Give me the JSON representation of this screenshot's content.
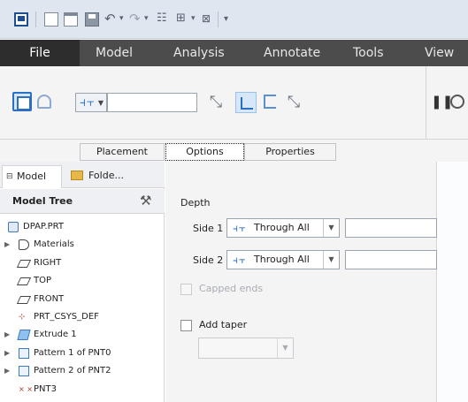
{
  "window": {
    "quick_access_chevron": "▾",
    "close_glyph": "⊠"
  },
  "menu": {
    "tabs": [
      "File",
      "Model",
      "Analysis",
      "Annotate",
      "Tools",
      "View"
    ]
  },
  "ribbon": {
    "depth_value": ""
  },
  "panel_tabs": {
    "placement": "Placement",
    "options": "Options",
    "properties": "Properties"
  },
  "model_tree": {
    "tab_label": "Model Tree",
    "folder_tab_label": "Folde...",
    "header": "Model Tree",
    "items": [
      {
        "label": "DPAP.PRT",
        "icon": "part-icon",
        "expandable": false
      },
      {
        "label": "Materials",
        "icon": "materials-icon",
        "expandable": true
      },
      {
        "label": "RIGHT",
        "icon": "datum-plane-icon",
        "expandable": false
      },
      {
        "label": "TOP",
        "icon": "datum-plane-icon",
        "expandable": false
      },
      {
        "label": "FRONT",
        "icon": "datum-plane-icon",
        "expandable": false
      },
      {
        "label": "PRT_CSYS_DEF",
        "icon": "coordinate-system-icon",
        "expandable": false
      },
      {
        "label": "Extrude 1",
        "icon": "extrude-icon",
        "expandable": true
      },
      {
        "label": "Pattern 1 of PNT0",
        "icon": "pattern-icon",
        "expandable": true
      },
      {
        "label": "Pattern 2 of PNT2",
        "icon": "pattern-icon",
        "expandable": true
      },
      {
        "label": "PNT3",
        "icon": "datum-point-icon",
        "expandable": false
      }
    ]
  },
  "options_panel": {
    "depth_heading": "Depth",
    "side1_label": "Side 1",
    "side1_value": "Through All",
    "side2_label": "Side 2",
    "side2_value": "Through All",
    "capped_ends_label": "Capped ends",
    "add_taper_label": "Add taper"
  }
}
